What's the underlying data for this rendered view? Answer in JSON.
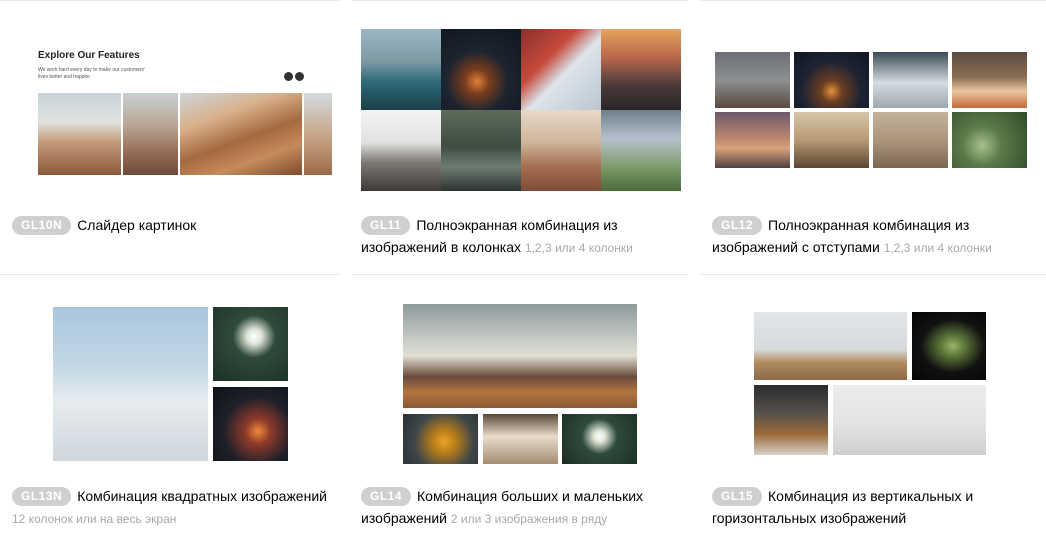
{
  "cards": [
    {
      "code": "GL10N",
      "title": "Слайдер картинок",
      "note": ""
    },
    {
      "code": "GL11",
      "title": "Полноэкранная комбинация из изображений в колонках",
      "note": "1,2,3 или 4 колонки"
    },
    {
      "code": "GL12",
      "title": "Полноэкранная комбинация из изображений с отступами",
      "note": "1,2,3 или 4 колонки"
    },
    {
      "code": "GL13N",
      "title": "Комбинация квадратных изображений",
      "note": "12 колонок или на весь экран"
    },
    {
      "code": "GL14",
      "title": "Комбинация больших и маленьких изображений",
      "note": "2 или 3 изображения в ряду"
    },
    {
      "code": "GL15",
      "title": "Комбинация из вертикальных и горизонтальных изображений",
      "note": ""
    }
  ],
  "slider_preview": {
    "heading": "Explore Our Features",
    "subtext": "We work hard every day to make our customers' lives better and happier"
  },
  "icons": {
    "prev": "chevron-left-icon",
    "next": "chevron-right-icon"
  }
}
